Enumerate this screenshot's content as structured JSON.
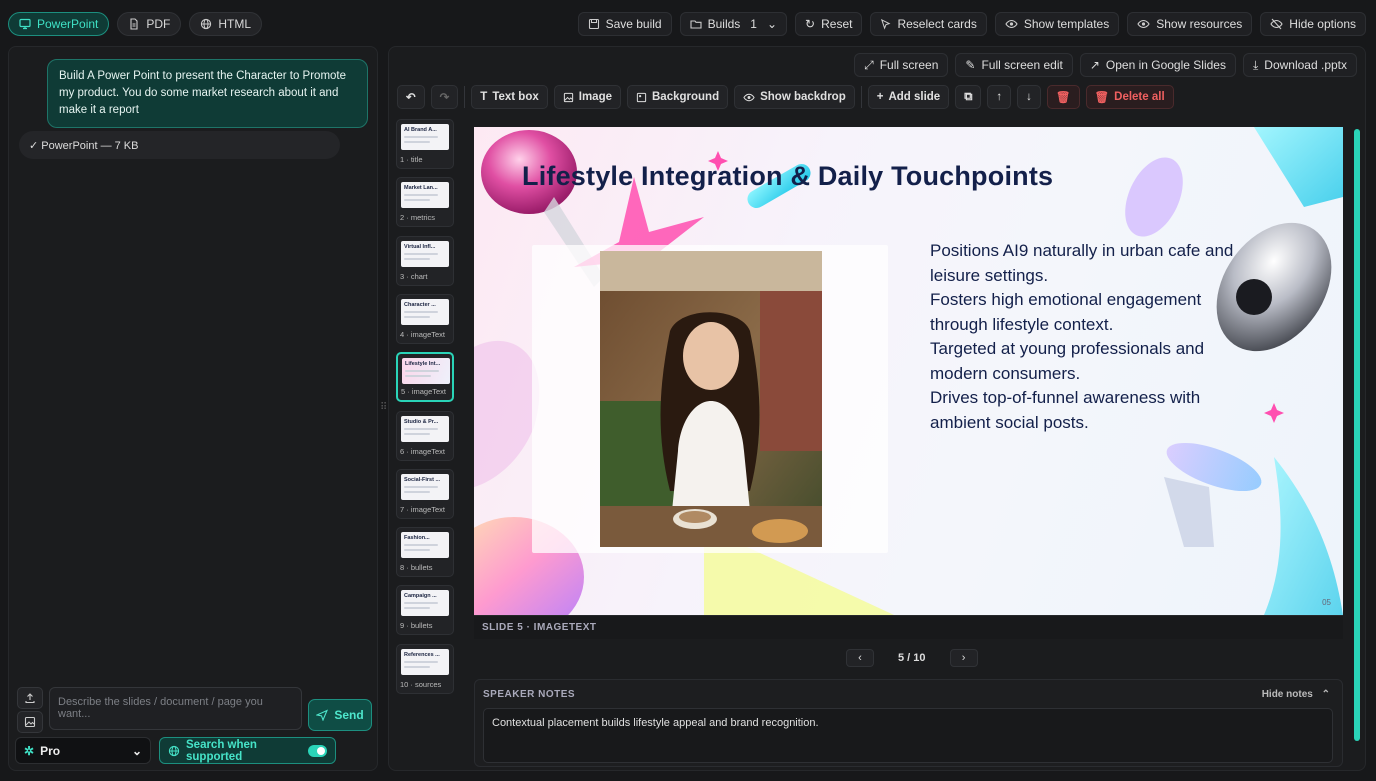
{
  "formats": [
    {
      "label": "PowerPoint",
      "icon": "presentation-icon",
      "active": true
    },
    {
      "label": "PDF",
      "icon": "document-icon"
    },
    {
      "label": "HTML",
      "icon": "globe-icon"
    }
  ],
  "top_actions": {
    "save_build": "Save build",
    "builds": "Builds",
    "builds_count": "1",
    "reset": "Reset",
    "reselect_cards": "Reselect cards",
    "show_templates": "Show templates",
    "show_resources": "Show resources",
    "hide_options": "Hide options"
  },
  "chat": {
    "user_message": "Build A Power Point to present the Character to Promote my product.  You do some market research about it and make it a report",
    "attachment": "✓ PowerPoint — 7 KB",
    "composer_placeholder": "Describe the slides / document / page you want...",
    "send_label": "Send",
    "model": "Pro",
    "search_label": "Search when supported",
    "search_enabled": true
  },
  "export_actions": {
    "full_screen": "Full screen",
    "full_screen_edit": "Full screen edit",
    "open_google": "Open in Google Slides",
    "download": "Download .pptx"
  },
  "editor_toolbar": {
    "text_box": "Text box",
    "image": "Image",
    "background": "Background",
    "show_backdrop": "Show backdrop",
    "add_slide": "Add slide",
    "delete_all": "Delete all"
  },
  "slides": [
    {
      "title": "AI Brand A...",
      "caption": "1 · title"
    },
    {
      "title": "Market Lan...",
      "caption": "2 · metrics"
    },
    {
      "title": "Virtual Infl...",
      "caption": "3 · chart"
    },
    {
      "title": "Character ...",
      "caption": "4 · imageText"
    },
    {
      "title": "Lifestyle Int...",
      "caption": "5 · imageText",
      "active": true
    },
    {
      "title": "Studio & Pr...",
      "caption": "6 · imageText"
    },
    {
      "title": "Social-First ...",
      "caption": "7 · imageText"
    },
    {
      "title": "Fashion...",
      "caption": "8 · bullets"
    },
    {
      "title": "Campaign ...",
      "caption": "9 · bullets"
    },
    {
      "title": "References ...",
      "caption": "10 · sources"
    }
  ],
  "current_slide": {
    "title": "Lifestyle Integration & Daily Touchpoints",
    "bullets": [
      "Positions AI9 naturally in urban cafe and leisure settings.",
      "Fosters high emotional engagement through lifestyle context.",
      "Targeted at young professionals and modern consumers.",
      "Drives top-of-funnel awareness with ambient social posts."
    ],
    "page_number": "05",
    "caption": "SLIDE 5 · IMAGETEXT"
  },
  "pager": {
    "label": "5 / 10"
  },
  "notes": {
    "header": "SPEAKER NOTES",
    "hide_label": "Hide notes",
    "text": "Contextual placement builds lifestyle appeal and brand recognition."
  },
  "colors": {
    "accent": "#2ad4b8",
    "accent_dark": "#0f3b36",
    "danger": "#f06060",
    "slide_title": "#13204a"
  }
}
